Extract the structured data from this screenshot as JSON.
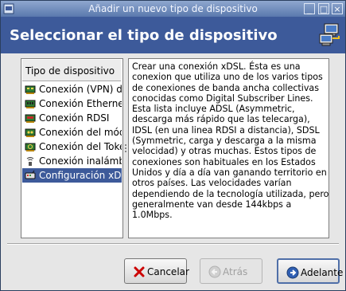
{
  "window": {
    "title": "Añadir un nuevo tipo de dispositivo",
    "controls": {
      "minimize": "_",
      "maximize": "□",
      "close": "×"
    }
  },
  "header": {
    "title": "Seleccionar el tipo de dispositivo"
  },
  "device_list": {
    "column_header": "Tipo de dispositivo",
    "items": [
      {
        "label": "Conexión (VPN) de C",
        "icon": "vpn-icon"
      },
      {
        "label": "Conexión Ethernet",
        "icon": "ethernet-card-icon"
      },
      {
        "label": "Conexión RDSI",
        "icon": "isdn-card-icon"
      },
      {
        "label": "Conexión del módem",
        "icon": "modem-icon"
      },
      {
        "label": "Conexión del Token",
        "icon": "token-ring-icon"
      },
      {
        "label": "Conexión inalámbric",
        "icon": "wireless-icon"
      },
      {
        "label": "Configuración xDSL",
        "icon": "xdsl-icon",
        "selected": true
      }
    ]
  },
  "description": {
    "text": "Crear una conexión xDSL. Ésta es una conexion que utiliza uno de los varios tipos de conexiones de banda ancha collectivas conocidas como Digital Subscriber Lines. Esta lista incluye ADSL (Asymmetric, descarga más rápido que las telecarga), IDSL (en una linea RDSI a distancia), SDSL (Symmetric, carga y descarga a la misma velocidad) y otras muchas. Estos tipos de conexiones son habituales en los Estados Unidos y día a día van ganando territorio en otros países. Las velocidades varían dependiendo de la tecnología utilizada, pero generalmente van desde 144kbps a 1.0Mbps."
  },
  "buttons": {
    "cancel": {
      "label": "Cancelar",
      "icon": "cancel-x-icon"
    },
    "back": {
      "label": "Atrás",
      "icon": "back-arrow-icon",
      "disabled": true
    },
    "forward": {
      "label": "Adelante",
      "icon": "forward-arrow-icon"
    }
  }
}
